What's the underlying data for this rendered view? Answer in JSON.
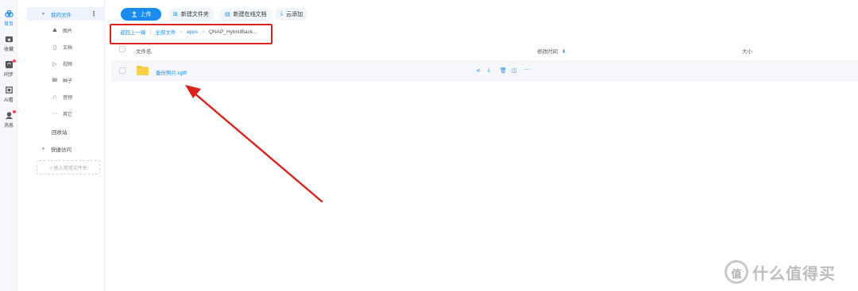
{
  "rail": {
    "items": [
      {
        "label": "首页",
        "icon": "home-cloud-icon",
        "badge": false
      },
      {
        "label": "收藏",
        "icon": "folder-star-icon",
        "badge": false
      },
      {
        "label": "同步",
        "icon": "sync-icon",
        "badge": true
      },
      {
        "label": "AI看",
        "icon": "ai-view-icon",
        "badge": false
      },
      {
        "label": "消息",
        "icon": "message-icon",
        "badge": true
      }
    ]
  },
  "tree": {
    "root_label": "我的文件",
    "more_label": "⋮",
    "children": [
      {
        "icon": "image-icon",
        "glyph": "⛰",
        "label": "图片"
      },
      {
        "icon": "document-icon",
        "glyph": "▯",
        "label": "文档"
      },
      {
        "icon": "video-icon",
        "glyph": "▷",
        "label": "视频"
      },
      {
        "icon": "torrent-icon",
        "glyph": "Bt",
        "label": "种子"
      },
      {
        "icon": "audio-icon",
        "glyph": "∩",
        "label": "音频"
      },
      {
        "icon": "other-icon",
        "glyph": "···",
        "label": "其它"
      }
    ],
    "recycle_label": "回收站",
    "quick_access_label": "快捷访问",
    "drop_hint": "+ 拖入常用文件夹"
  },
  "toolbar": {
    "upload_label": "上传",
    "new_folder_label": "新建文件夹",
    "new_doc_label": "新建在线文档",
    "cloud_add_label": "云添加"
  },
  "breadcrumb": {
    "back": "返回上一级",
    "all": "全部文件",
    "apps": "apps",
    "current": "QNAP_HybridBack..."
  },
  "table": {
    "col_name": "文件名",
    "col_modified": "修改时间",
    "col_size": "大小",
    "rows": [
      {
        "name": "备份照片.rgtff",
        "type": "folder"
      }
    ]
  },
  "colors": {
    "accent": "#1a8cf0",
    "annotation": "#d9231b"
  },
  "watermark": {
    "logo_char": "值",
    "text": "什么值得买"
  }
}
